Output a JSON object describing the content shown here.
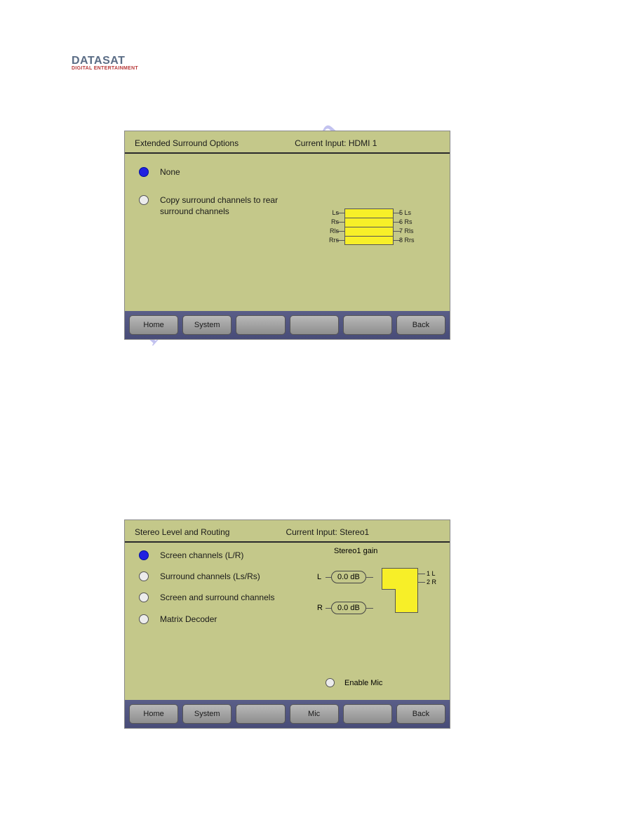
{
  "logo": {
    "main": "DATASAT",
    "sub": "DIGITAL ENTERTAINMENT"
  },
  "watermark": "manualshive.com",
  "panel1": {
    "title": "Extended Surround Options",
    "current_input": "Current Input: HDMI 1",
    "options": [
      {
        "label": "None",
        "selected": true
      },
      {
        "label": "Copy surround channels to rear surround channels",
        "selected": false
      }
    ],
    "routing": {
      "left_labels": [
        "Ls",
        "Rs",
        "Rls",
        "Rrs"
      ],
      "right_labels": [
        "5 Ls",
        "6 Rs",
        "7 Rls",
        "8 Rrs"
      ]
    },
    "buttons": [
      "Home",
      "System",
      "",
      "",
      "",
      "Back"
    ]
  },
  "panel2": {
    "title": "Stereo Level and Routing",
    "current_input": "Current Input: Stereo1",
    "options": [
      {
        "label": "Screen channels (L/R)",
        "selected": true
      },
      {
        "label": "Surround channels (Ls/Rs)",
        "selected": false
      },
      {
        "label": "Screen and surround channels",
        "selected": false
      },
      {
        "label": "Matrix Decoder",
        "selected": false
      }
    ],
    "gain": {
      "title": "Stereo1 gain",
      "channels": [
        {
          "name": "L",
          "value": "0.0 dB",
          "out": "1 L"
        },
        {
          "name": "R",
          "value": "0.0 dB",
          "out": "2 R"
        }
      ]
    },
    "enable_mic_label": "Enable Mic",
    "buttons": [
      "Home",
      "System",
      "",
      "Mic",
      "",
      "Back"
    ]
  }
}
